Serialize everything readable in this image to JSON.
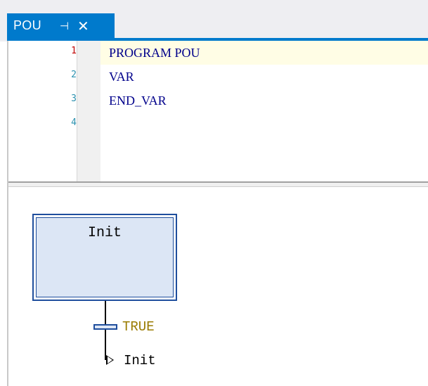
{
  "tab": {
    "title": "POU",
    "pin_icon": "pin-icon",
    "close_icon": "close-icon"
  },
  "declaration": {
    "lines": [
      {
        "number": "1",
        "code": "PROGRAM POU"
      },
      {
        "number": "2",
        "code": "VAR"
      },
      {
        "number": "3",
        "code": "END_VAR"
      },
      {
        "number": "4",
        "code": ""
      }
    ],
    "current_line": 1
  },
  "sfc": {
    "step_name": "Init",
    "transition_condition": "TRUE",
    "jump_target": "Init"
  },
  "colors": {
    "accent": "#007acc",
    "step_border": "#1f4e9d",
    "step_fill": "#dce6f5",
    "keyword": "#00008b",
    "line_number": "#2b91af",
    "current_line_number": "#c00000",
    "condition": "#9a7b00"
  }
}
